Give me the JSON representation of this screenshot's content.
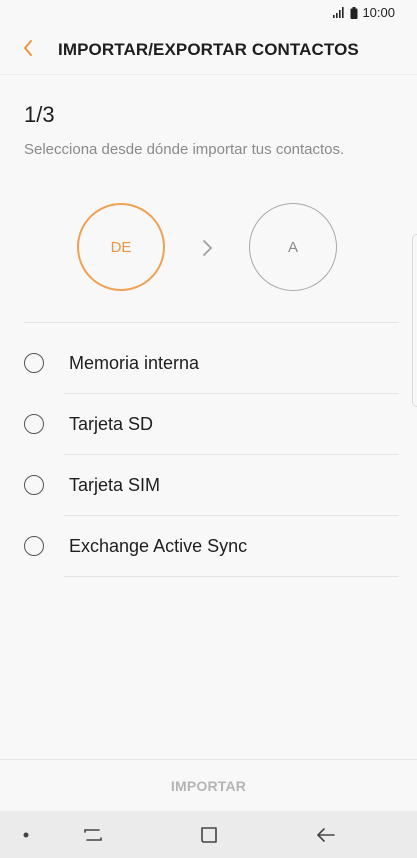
{
  "status_bar": {
    "time": "10:00",
    "icons": [
      "signal-icon",
      "battery-icon"
    ]
  },
  "header": {
    "title": "IMPORTAR/EXPORTAR CONTACTOS",
    "back_icon": "chevron-left-icon"
  },
  "step": {
    "count": "1/3",
    "instructions": "Selecciona desde dónde importar tus contactos.",
    "from_label": "DE",
    "to_label": "A"
  },
  "options": [
    {
      "label": "Memoria interna",
      "selected": false
    },
    {
      "label": "Tarjeta SD",
      "selected": false
    },
    {
      "label": "Tarjeta SIM",
      "selected": false
    },
    {
      "label": "Exchange Active Sync",
      "selected": false
    }
  ],
  "footer": {
    "import_label": "IMPORTAR"
  },
  "navbar": {
    "items": [
      "dot-icon",
      "recents-icon",
      "home-icon",
      "back-arrow-icon"
    ]
  },
  "colors": {
    "accent": "#ee9440",
    "muted": "#8a8a8a",
    "disabled": "#b4b4b4"
  }
}
